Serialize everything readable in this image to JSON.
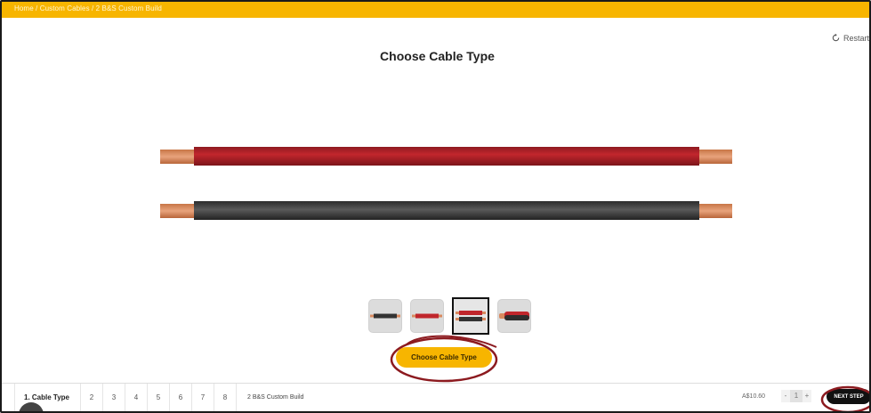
{
  "breadcrumb": "Home / Custom Cables / 2 B&S Custom Build",
  "restart_label": "Restart",
  "title": "Choose Cable Type",
  "cable_options": [
    {
      "icon": "single-cable-icon",
      "selected": false
    },
    {
      "icon": "single-red-cable-icon",
      "selected": false
    },
    {
      "icon": "twin-cable-icon",
      "selected": true
    },
    {
      "icon": "twin-sheathed-cable-icon",
      "selected": false
    }
  ],
  "cta_label": "Choose Cable Type",
  "steps": [
    {
      "label": "1. Cable Type"
    },
    {
      "label": "2"
    },
    {
      "label": "3"
    },
    {
      "label": "4"
    },
    {
      "label": "5"
    },
    {
      "label": "6"
    },
    {
      "label": "7"
    },
    {
      "label": "8"
    }
  ],
  "product_name": "2 B&S Custom Build",
  "price": "A$10.60",
  "quantity": "1",
  "minus_label": "-",
  "plus_label": "+",
  "next_step_label": "NEXT STEP",
  "colors": {
    "accent": "#f7b500",
    "cable_red": "#b3232a",
    "cable_black": "#3a3a3a",
    "copper": "#d98a5f",
    "annotation": "#8c1a1f"
  }
}
